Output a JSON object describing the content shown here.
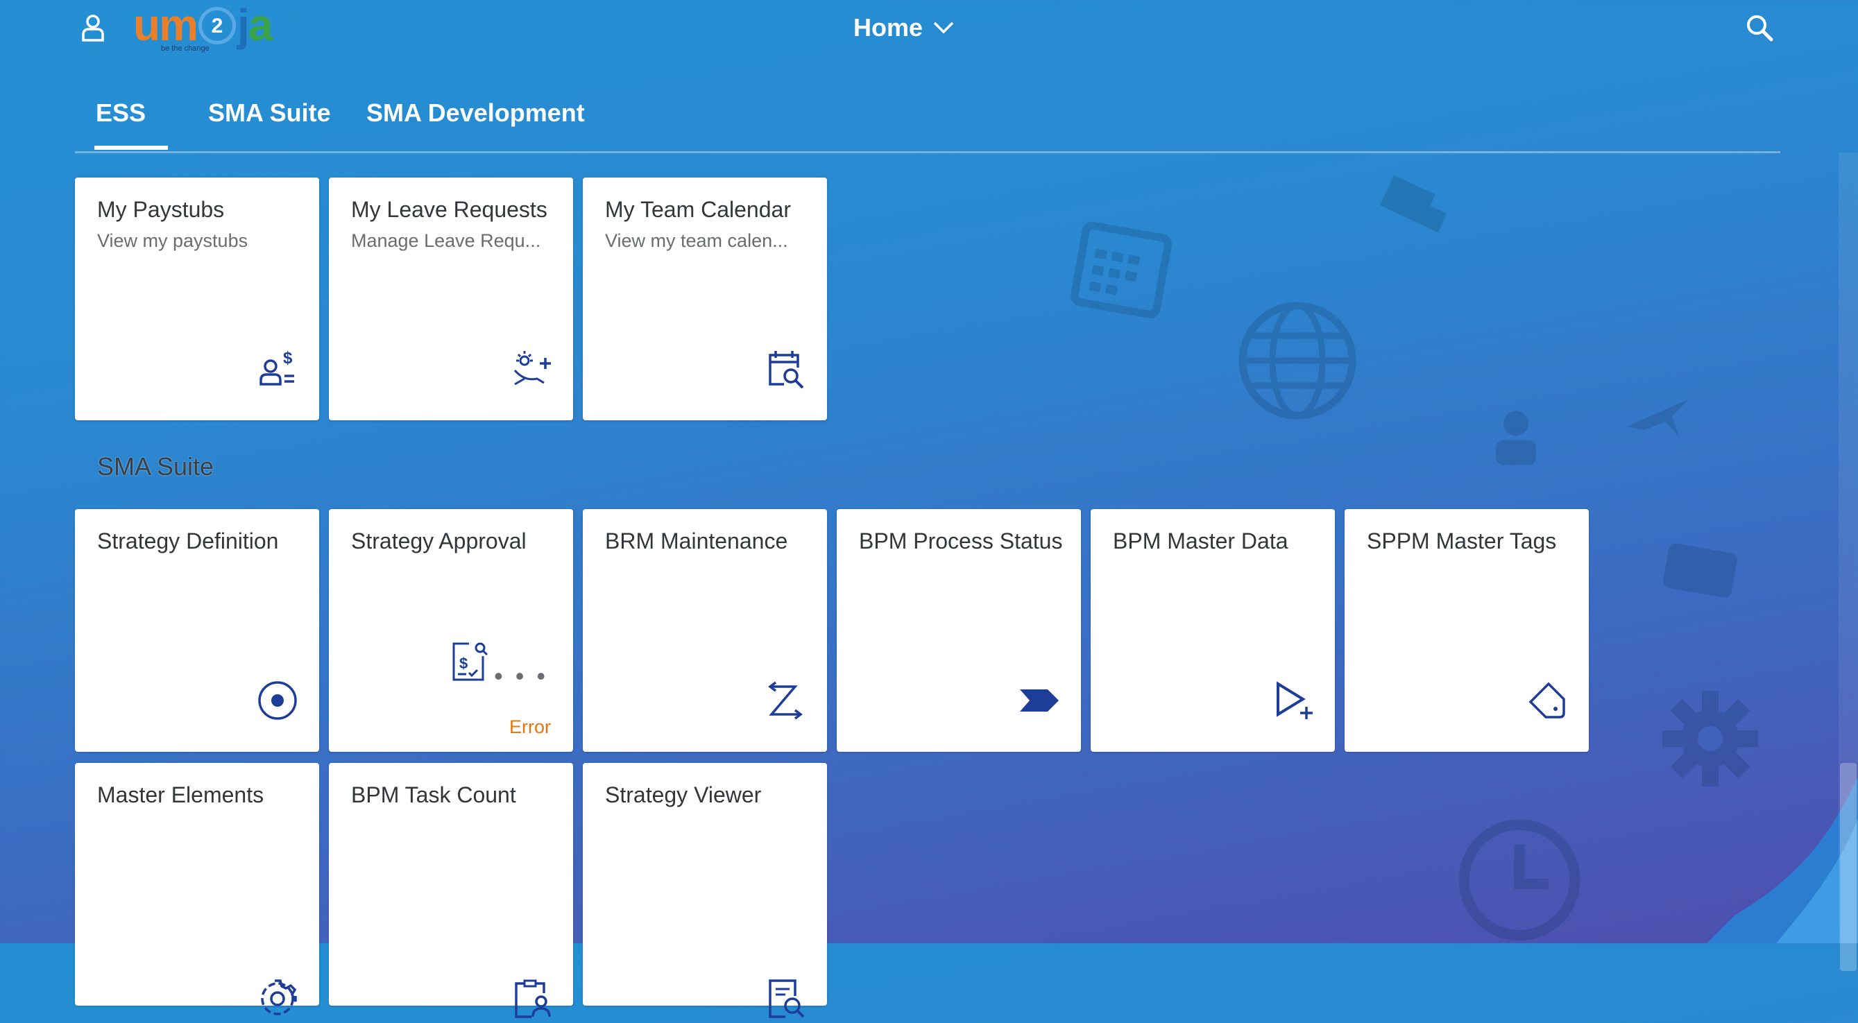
{
  "shell": {
    "home_label": "Home",
    "logo": {
      "part1": "um",
      "ring": "2",
      "part2": "j",
      "part3": "a",
      "tagline": "be the change"
    }
  },
  "tabs": [
    {
      "label": "ESS",
      "active": true
    },
    {
      "label": "SMA Suite",
      "active": false
    },
    {
      "label": "SMA Development",
      "active": false
    }
  ],
  "ess_tiles": [
    {
      "title": "My Paystubs",
      "subtitle": "View my paystubs",
      "icon": "employee-pay-icon"
    },
    {
      "title": "My Leave Requests",
      "subtitle": "Manage Leave Requ...",
      "icon": "leave-request-icon"
    },
    {
      "title": "My Team Calendar",
      "subtitle": "View my team calen...",
      "icon": "calendar-search-icon"
    }
  ],
  "sma_group_title": "SMA Suite",
  "sma_tiles": [
    {
      "title": "Strategy Definition",
      "icon": "target-icon"
    },
    {
      "title": "Strategy Approval",
      "icon": "expense-document-icon",
      "more": "• • •",
      "status": "Error"
    },
    {
      "title": "BRM Maintenance",
      "icon": "transfer-icon"
    },
    {
      "title": "BPM Process Status",
      "icon": "process-chevron-icon"
    },
    {
      "title": "BPM Master Data",
      "icon": "play-add-icon"
    },
    {
      "title": "SPPM Master Tags",
      "icon": "tag-icon"
    },
    {
      "title": "Master Elements",
      "icon": "gear-icon"
    },
    {
      "title": "BPM Task Count",
      "icon": "clipboard-person-icon"
    },
    {
      "title": "Strategy Viewer",
      "icon": "document-search-icon"
    }
  ],
  "colors": {
    "icon": "#1d3d99",
    "error": "#e9730c",
    "tile_title": "#32363a"
  }
}
